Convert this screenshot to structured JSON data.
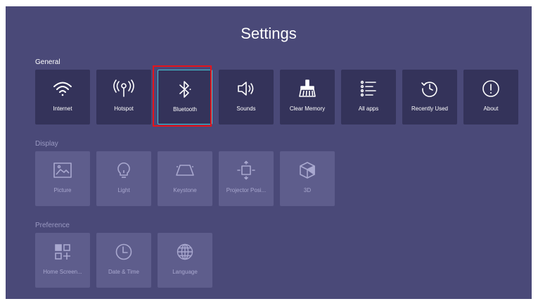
{
  "title": "Settings",
  "sections": [
    {
      "label": "General",
      "items": [
        {
          "label": "Internet",
          "icon": "wifi-icon"
        },
        {
          "label": "Hotspot",
          "icon": "hotspot-icon"
        },
        {
          "label": "Bluetooth",
          "icon": "bluetooth-icon"
        },
        {
          "label": "Sounds",
          "icon": "speaker-icon"
        },
        {
          "label": "Clear Memory",
          "icon": "broom-icon"
        },
        {
          "label": "All apps",
          "icon": "list-icon"
        },
        {
          "label": "Recently Used",
          "icon": "history-icon"
        },
        {
          "label": "About",
          "icon": "info-icon"
        }
      ]
    },
    {
      "label": "Display",
      "items": [
        {
          "label": "Picture",
          "icon": "picture-icon"
        },
        {
          "label": "Light",
          "icon": "lightbulb-icon"
        },
        {
          "label": "Keystone",
          "icon": "keystone-icon"
        },
        {
          "label": "Projector Posi...",
          "icon": "projector-position-icon"
        },
        {
          "label": "3D",
          "icon": "cube-icon"
        }
      ]
    },
    {
      "label": "Preference",
      "items": [
        {
          "label": "Home Screen...",
          "icon": "home-screen-icon"
        },
        {
          "label": "Date & Time",
          "icon": "clock-icon"
        },
        {
          "label": "Language",
          "icon": "globe-icon"
        }
      ]
    }
  ],
  "selected_item": "Bluetooth",
  "colors": {
    "background": "#4a4978",
    "tile_active": "#34335a",
    "tile_dim": "#5e5d8c",
    "focus_outline": "#46c7d4",
    "highlight_box": "#e5141b"
  }
}
